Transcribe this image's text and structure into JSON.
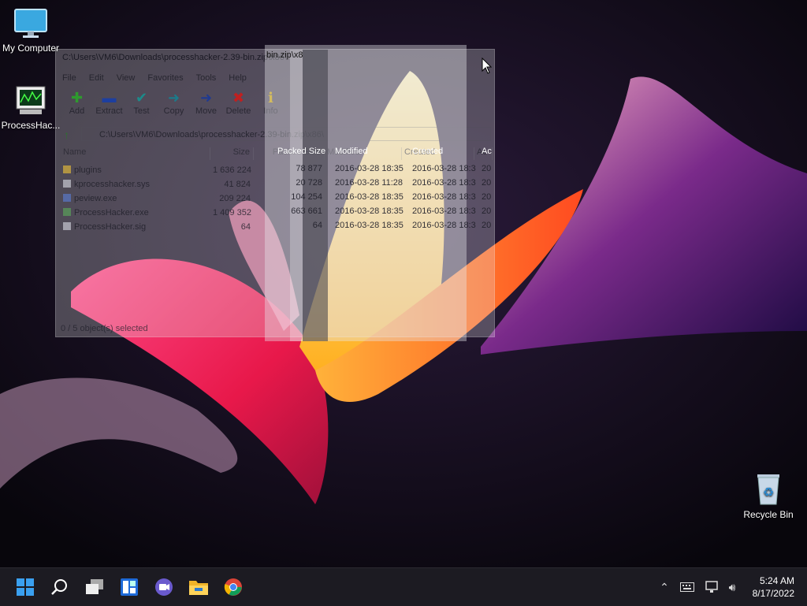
{
  "desktop": {
    "icons": [
      {
        "label": "My Computer",
        "icon": "monitor-icon"
      },
      {
        "label": "ProcessHac...",
        "icon": "process-hacker-icon"
      },
      {
        "label": "Recycle Bin",
        "icon": "recycle-bin-icon"
      }
    ]
  },
  "window": {
    "title": "C:\\Users\\VM6\\Downloads\\processhacker-2.39-bin.zip\\x86\\",
    "title_overlay": "bin.zip\\x8",
    "menu": [
      "File",
      "Edit",
      "View",
      "Favorites",
      "Tools",
      "Help"
    ],
    "toolbar": [
      {
        "label": "Add",
        "icon": "add-icon",
        "color": "#2e9a2e"
      },
      {
        "label": "Extract",
        "icon": "extract-icon",
        "color": "#1d3fa0"
      },
      {
        "label": "Test",
        "icon": "test-icon",
        "color": "#1c8a8a"
      },
      {
        "label": "Copy",
        "icon": "copy-icon",
        "color": "#1c7a8a"
      },
      {
        "label": "Move",
        "icon": "move-icon",
        "color": "#203a90"
      },
      {
        "label": "Delete",
        "icon": "delete-icon",
        "color": "#c02020"
      },
      {
        "label": "Info",
        "icon": "info-icon",
        "color": "#c8a000"
      }
    ],
    "address": "C:\\Users\\VM6\\Downloads\\processhacker-2.39-bin.zip\\x86\\",
    "columns": {
      "name": "Name",
      "size": "Size",
      "packed": "Packed Size",
      "modified": "Modified",
      "created": "Created",
      "accessed": "Ac"
    },
    "files": [
      {
        "name": "plugins",
        "size": "1 636 224",
        "packed": "78 877",
        "modified": "2016-03-28 18:35",
        "created": "2016-03-28 18:3",
        "accessed": "20",
        "type": "folder"
      },
      {
        "name": "kprocesshacker.sys",
        "size": "41 824",
        "packed": "20 728",
        "modified": "2016-03-28 11:28",
        "created": "2016-03-28 18:3",
        "accessed": "20",
        "type": "file"
      },
      {
        "name": "peview.exe",
        "size": "209 224",
        "packed": "104 254",
        "modified": "2016-03-28 18:35",
        "created": "2016-03-28 18:3",
        "accessed": "20",
        "type": "exe"
      },
      {
        "name": "ProcessHacker.exe",
        "size": "1 409 352",
        "packed": "663 661",
        "modified": "2016-03-28 18:35",
        "created": "2016-03-28 18:3",
        "accessed": "20",
        "type": "exe"
      },
      {
        "name": "ProcessHacker.sig",
        "size": "64",
        "packed": "64",
        "modified": "2016-03-28 18:35",
        "created": "2016-03-28 18:3",
        "accessed": "20",
        "type": "file"
      }
    ],
    "status": "0 / 5 object(s) selected"
  },
  "taskbar": {
    "apps": [
      {
        "name": "start-button",
        "icon": "windows-icon"
      },
      {
        "name": "search-button",
        "icon": "search-icon"
      },
      {
        "name": "task-view-button",
        "icon": "task-view-icon"
      },
      {
        "name": "widgets-button",
        "icon": "widgets-icon"
      },
      {
        "name": "chat-button",
        "icon": "chat-icon"
      },
      {
        "name": "file-explorer-button",
        "icon": "folder-icon"
      },
      {
        "name": "chrome-button",
        "icon": "chrome-icon"
      }
    ],
    "clock": {
      "time": "5:24 AM",
      "date": "8/17/2022"
    }
  }
}
